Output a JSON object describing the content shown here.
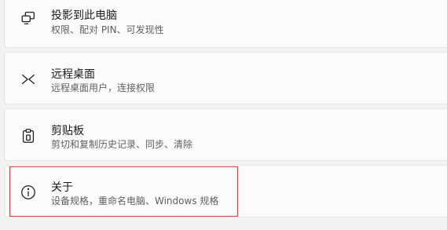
{
  "settings": {
    "items": [
      {
        "title": "投影到此电脑",
        "subtitle": "权限、配对 PIN、可发现性",
        "icon": "project-to-pc-icon"
      },
      {
        "title": "远程桌面",
        "subtitle": "远程桌面用户，连接权限",
        "icon": "remote-desktop-icon"
      },
      {
        "title": "剪贴板",
        "subtitle": "剪切和复制历史记录、同步、清除",
        "icon": "clipboard-icon"
      },
      {
        "title": "关于",
        "subtitle": "设备规格，重命名电脑、Windows 规格",
        "icon": "info-icon"
      }
    ]
  },
  "colors": {
    "background": "#f3f3f3",
    "card": "#fbfbfb",
    "highlight": "#e0393e"
  }
}
